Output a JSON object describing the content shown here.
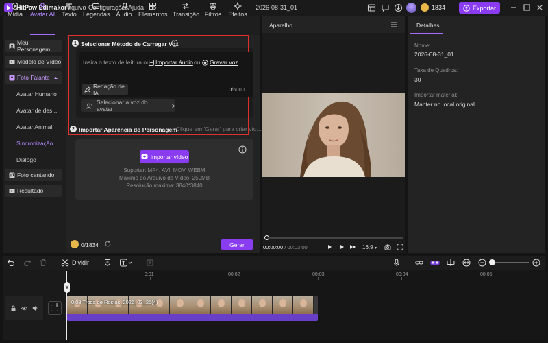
{
  "app": {
    "name": "HitPaw Edimakor",
    "project_title": "2026-08-31_01"
  },
  "menu": [
    "Arquivo",
    "Configurações",
    "Ajuda"
  ],
  "account": {
    "credits": "1834",
    "export_label": "Exportar"
  },
  "tabs": [
    {
      "label": "Mídia",
      "icon": "media-icon"
    },
    {
      "label": "Avatar AI",
      "icon": "avatar-ai-icon",
      "active": true
    },
    {
      "label": "Texto",
      "icon": "text-icon"
    },
    {
      "label": "Legendas",
      "icon": "subtitles-icon"
    },
    {
      "label": "Áudio",
      "icon": "music-note-icon"
    },
    {
      "label": "Elementos",
      "icon": "elements-icon"
    },
    {
      "label": "Transição",
      "icon": "transition-icon"
    },
    {
      "label": "Filtros",
      "icon": "filter-icon"
    },
    {
      "label": "Efeitos",
      "icon": "effects-icon"
    }
  ],
  "sidebar": {
    "meu_personagem": "Meu Personagem",
    "modelo_video": "Modelo de Vídeo",
    "foto_falante": "Foto Falante",
    "sub": [
      "Avatar Humano",
      "Avatar de des...",
      "Avatar Animal",
      "Sincronizaçâo...",
      "Diálogo"
    ],
    "foto_cantando": "Foto cantando",
    "resultado": "Resultado"
  },
  "editor": {
    "step1_num": "1",
    "step1_title": "Selecionar Método de Carregar Voz",
    "placeholder_prefix": "Insira o texto de leitura ou",
    "import_audio": "Importar áudio",
    "or": "ou",
    "record_voice": "Gravar voz",
    "ai_writing": "Redação de IA",
    "char_count": "0",
    "char_max": "/5000",
    "select_voice": "Selecionar a voz do avatar",
    "step2_num": "2",
    "step2_title": "Importar Aparência do Personagem",
    "step2_hint": "Clique em 'Gerar' para criar víd...",
    "import_video": "Importar vídeo",
    "supported": "Suportar: MP4, AVI, MOV, WEBM",
    "max_size": "Máximo do Arquivo de Vídeo: 250MB",
    "max_res": "Resolução máxima: 3840*3840",
    "credit_use": "0/1834",
    "generate": "Gerar"
  },
  "preview": {
    "title": "Aparelho",
    "current_time": "00:00:00",
    "total_time": "/ 00:03:00",
    "ratio": "16:9"
  },
  "details": {
    "tab": "Detalhes",
    "name_label": "Nome:",
    "name_value": "2026-08-31_01",
    "fps_label": "Taxa de Quadros:",
    "fps_value": "30",
    "import_label": "Importar material:",
    "import_value": "Manter no local original"
  },
  "timeline": {
    "split": "Dividir",
    "ruler": [
      "0:01",
      "00:02",
      "00:03",
      "00:04",
      "00:05"
    ],
    "clip_label": "0:03  Troca de Rostos_2026_03_25(4)"
  }
}
